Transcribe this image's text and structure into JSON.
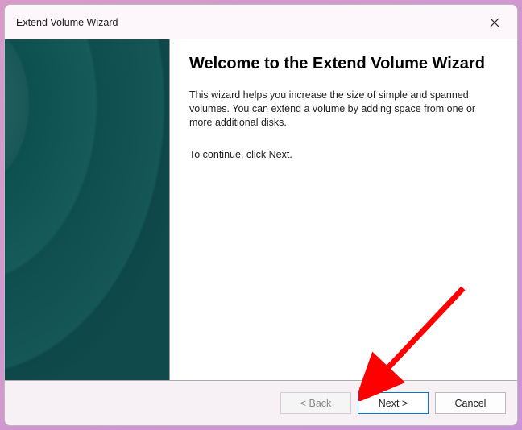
{
  "titlebar": {
    "title": "Extend Volume Wizard"
  },
  "main": {
    "heading": "Welcome to the Extend Volume Wizard",
    "body": "This wizard helps you increase the size of simple and spanned volumes. You can extend a volume  by adding space from one or more additional disks.",
    "continue": "To continue, click Next."
  },
  "buttons": {
    "back": "< Back",
    "next": "Next >",
    "cancel": "Cancel"
  }
}
